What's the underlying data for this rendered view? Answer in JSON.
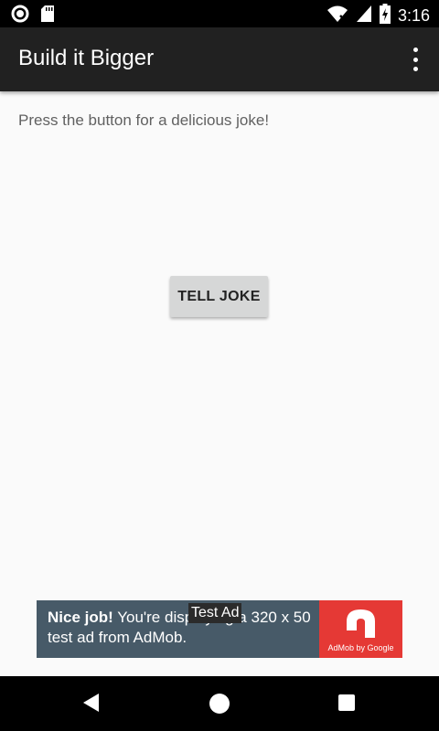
{
  "status_bar": {
    "time": "3:16",
    "icons": [
      "notification-circle-icon",
      "sd-card-icon",
      "wifi-icon",
      "cellular-signal-icon",
      "battery-charging-icon"
    ]
  },
  "app_bar": {
    "title": "Build it Bigger",
    "overflow_icon": "more-vert-icon"
  },
  "main": {
    "prompt": "Press the button for a delicious joke!",
    "button_label": "TELL JOKE"
  },
  "ad": {
    "headline": "Nice job!",
    "body": " You're displaying a 320 x 50 test ad from AdMob.",
    "badge": "Test Ad",
    "logo_text": "AdMob by Google",
    "background": "#475a68",
    "logo_color": "#e53935"
  },
  "nav_bar": {
    "icons": [
      "back-icon",
      "home-icon",
      "recents-icon"
    ]
  },
  "colors": {
    "app_bar": "#212121",
    "background": "#fafafa",
    "button": "#d6d7d7"
  }
}
